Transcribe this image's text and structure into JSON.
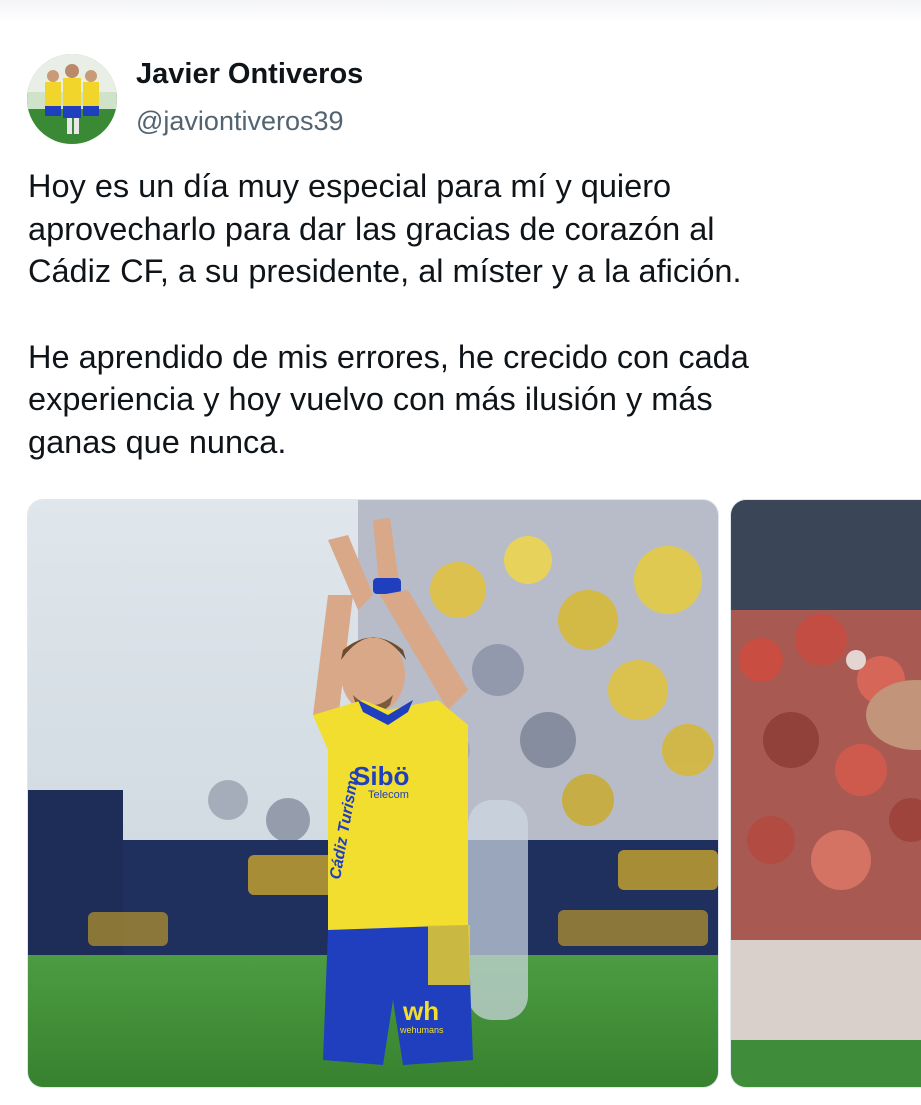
{
  "author": {
    "name": "Javier Ontiveros",
    "handle": "@javiontiveros39",
    "avatar_icon": "profile-photo-player"
  },
  "tweet": {
    "paragraph_1": "Hoy es un día muy especial para mí y quiero\naprovecharlo para dar las gracias de corazón al\nCádiz CF, a su presidente, al míster y a la afición.",
    "paragraph_2": "He aprendido de mis errores, he crecido con cada\nexperiencia y hoy vuelvo con más ilusión y más\nganas que nunca."
  },
  "media": {
    "count_visible": 2,
    "photo_1_icon": "photo-player-applauding",
    "photo_2_icon": "photo-stadium-crowd"
  },
  "colors": {
    "text_primary": "#0f1419",
    "text_secondary": "#536471",
    "jersey_yellow": "#f2de2e",
    "shorts_blue": "#1f3fbf",
    "pitch_green": "#3f8d3a"
  }
}
